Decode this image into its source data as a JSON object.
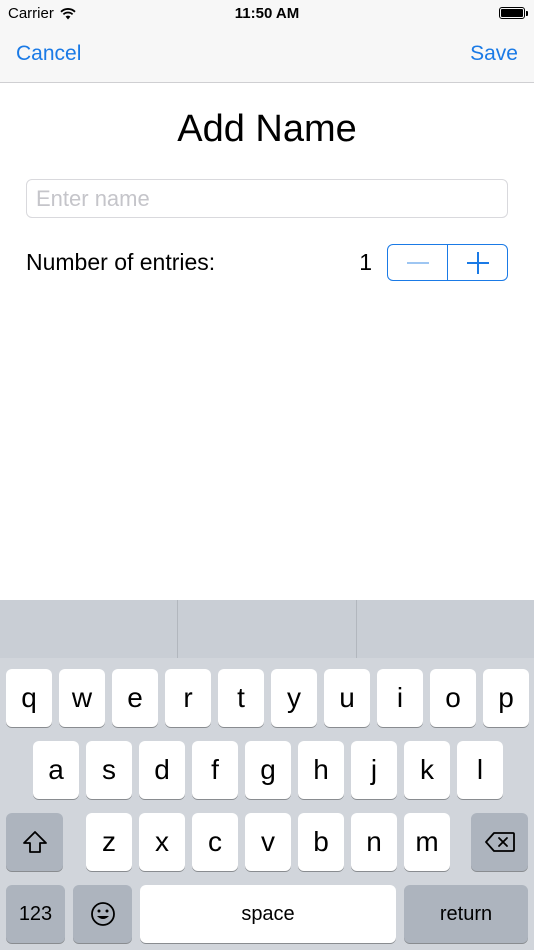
{
  "status_bar": {
    "carrier": "Carrier",
    "time": "11:50 AM"
  },
  "nav": {
    "cancel_label": "Cancel",
    "save_label": "Save"
  },
  "form": {
    "title": "Add Name",
    "name_placeholder": "Enter name",
    "name_value": "",
    "entries_label": "Number of entries:",
    "entries_value": "1"
  },
  "keyboard": {
    "row1": [
      "q",
      "w",
      "e",
      "r",
      "t",
      "y",
      "u",
      "i",
      "o",
      "p"
    ],
    "row2": [
      "a",
      "s",
      "d",
      "f",
      "g",
      "h",
      "j",
      "k",
      "l"
    ],
    "row3": [
      "z",
      "x",
      "c",
      "v",
      "b",
      "n",
      "m"
    ],
    "numbers_label": "123",
    "space_label": "space",
    "return_label": "return"
  },
  "colors": {
    "accent": "#1a7ae6",
    "keyboard_bg": "#d1d5db",
    "dark_key": "#adb4be"
  }
}
